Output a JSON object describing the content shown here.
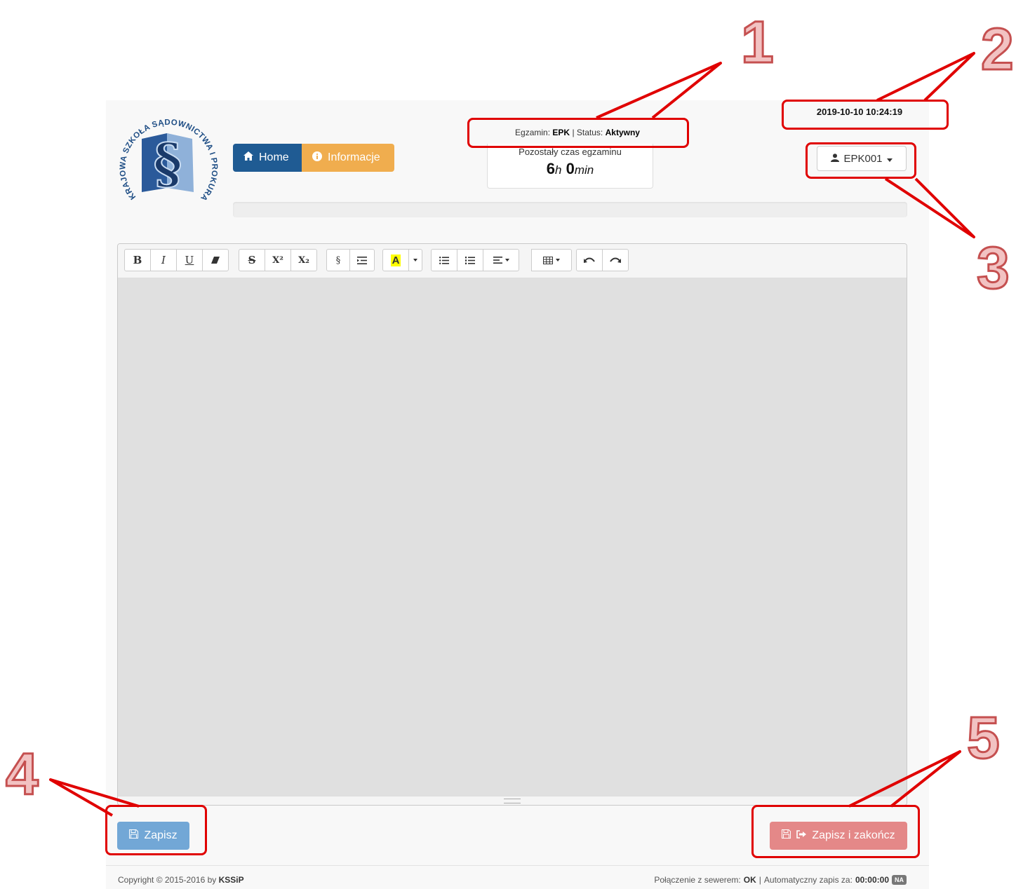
{
  "logo": {
    "text": "KRAJOWA SZKOŁA SĄDOWNICTWA I PROKURATURY"
  },
  "nav": {
    "home_label": "Home",
    "info_label": "Informacje"
  },
  "status": {
    "exam_label": "Egzamin:",
    "exam_value": "EPK",
    "separator": "|",
    "status_label": "Status:",
    "status_value": "Aktywny"
  },
  "timer": {
    "title": "Pozostały czas egzaminu",
    "hours": "6",
    "hours_unit": "h",
    "minutes": "0",
    "minutes_unit": "min"
  },
  "datetime": "2019-10-10 10:24:19",
  "user": {
    "name": "EPK001"
  },
  "progress": {
    "value": 0
  },
  "toolbar": {
    "bold": "B",
    "italic": "I",
    "underline": "U",
    "strike": "S",
    "superscript": "X²",
    "subscript": "X₂",
    "paragraph": "§",
    "highlight": "A"
  },
  "buttons": {
    "save_label": "Zapisz",
    "save_finish_label": "Zapisz i zakończ"
  },
  "footer": {
    "copyright_prefix": "Copyright © 2015-2016 by",
    "copyright_owner": "KSSiP",
    "conn_label": "Połączenie z sewerem:",
    "conn_value": "OK",
    "conn_sep": "|",
    "autosave_label": "Automatyczny zapis za:",
    "autosave_value": "00:00:00",
    "badge": "NA"
  },
  "annotations": {
    "n1": "1",
    "n2": "2",
    "n3": "3",
    "n4": "4",
    "n5": "5",
    "color": "#e00000"
  },
  "colors": {
    "home": "#1f5b93",
    "info": "#f0ad4e",
    "save": "#72a7d6",
    "save_finish": "#e48888"
  }
}
